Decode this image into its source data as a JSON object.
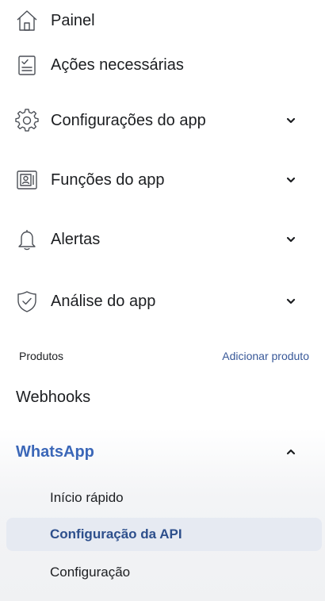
{
  "nav": {
    "items": [
      {
        "label": "Painel",
        "icon": "home-icon"
      },
      {
        "label": "Ações necessárias",
        "icon": "checklist-icon"
      },
      {
        "label": "Configurações do app",
        "icon": "gear-icon"
      },
      {
        "label": "Funções do app",
        "icon": "id-card-icon"
      },
      {
        "label": "Alertas",
        "icon": "bell-icon"
      },
      {
        "label": "Análise do app",
        "icon": "shield-check-icon"
      }
    ]
  },
  "products": {
    "title": "Produtos",
    "add_link": "Adicionar produto",
    "webhooks_label": "Webhooks",
    "whatsapp": {
      "label": "WhatsApp",
      "expanded": true,
      "subitems": [
        {
          "label": "Início rápido",
          "active": false
        },
        {
          "label": "Configuração da API",
          "active": true
        },
        {
          "label": "Configuração",
          "active": false
        }
      ]
    }
  },
  "colors": {
    "accent": "#3b67b8",
    "link": "#385898",
    "active_bg": "#e6eaf2",
    "text": "#1c1e21"
  }
}
